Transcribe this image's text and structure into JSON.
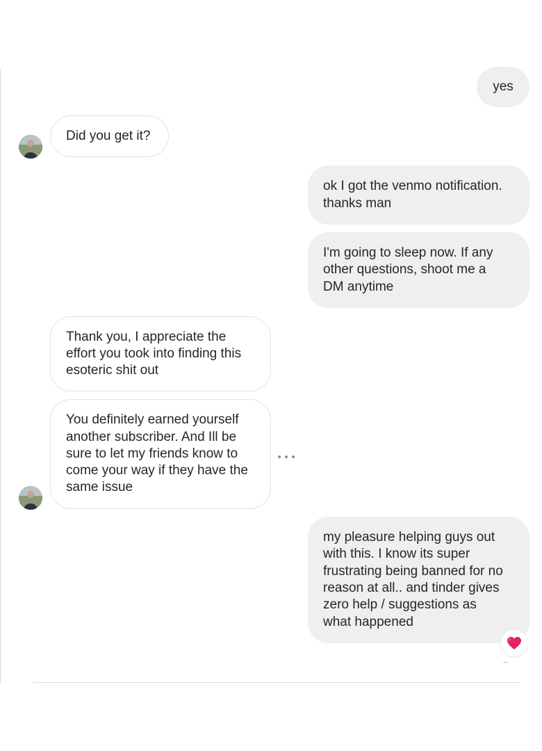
{
  "thread": {
    "messages": [
      {
        "direction": "outgoing",
        "text": "yes"
      },
      {
        "direction": "incoming",
        "text": "Did you get it?"
      },
      {
        "direction": "outgoing",
        "text": "ok I got the venmo notification.\nthanks man"
      },
      {
        "direction": "outgoing",
        "text": "I'm going to sleep now. If any\nother questions, shoot me a\nDM anytime"
      },
      {
        "direction": "incoming",
        "text": "Thank you, I appreciate the\neffort you took into finding this\nesoteric shit out"
      },
      {
        "direction": "incoming",
        "text": "You definitely earned yourself\nanother subscriber. And Ill be\nsure to let my friends know to\ncome your way if they have the\nsame issue"
      },
      {
        "direction": "outgoing",
        "text": "my pleasure helping guys out\nwith this. I know its super\nfrustrating being banned for no\nreason at all.. and tinder gives\nzero help / suggestions as\nwhat happened",
        "reaction": "heart"
      }
    ]
  },
  "icons": {
    "more_options": "more-horizontal-icon",
    "reaction": "red-heart-icon",
    "avatar": "user-avatar"
  },
  "colors": {
    "outgoing_bubble": "#efefef",
    "incoming_border": "#e3e3e3",
    "text": "#262626",
    "heart": "#e0245e",
    "divider": "#dbdbdb"
  }
}
